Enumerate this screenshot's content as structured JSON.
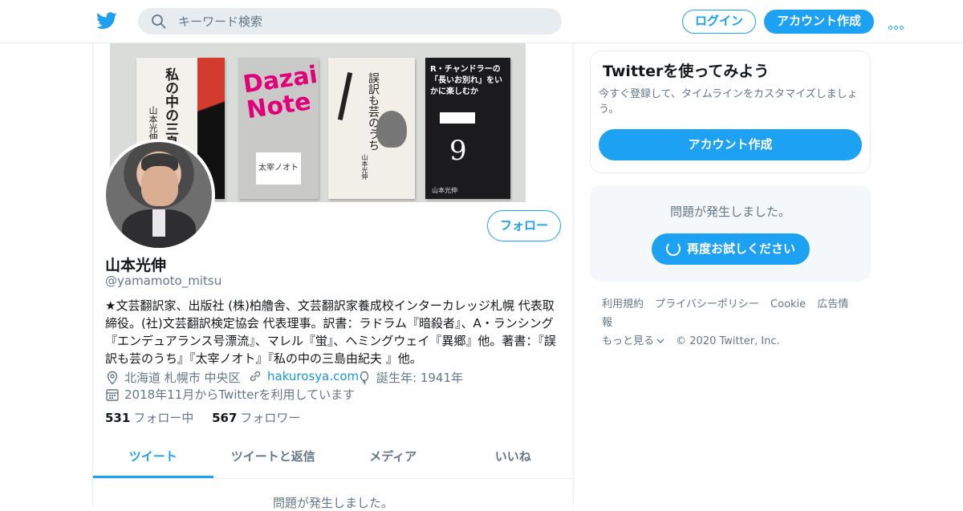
{
  "header": {
    "search_placeholder": "キーワード検索",
    "login": "ログイン",
    "signup": "アカウント作成"
  },
  "banner": {
    "books": [
      {
        "title": "私の中の三島由紀夫",
        "author": "山本光伸"
      },
      {
        "title": "Dazai Note",
        "subtitle": "太宰ノオト"
      },
      {
        "title": "誤訳も芸のうち",
        "author": "山本光伸"
      },
      {
        "title": "R・チャンドラーの「長いお別れ」をいかに楽しむか",
        "author": "山本光伸"
      }
    ]
  },
  "profile": {
    "follow_button": "フォロー",
    "name": "山本光伸",
    "handle": "@yamamoto_mitsu",
    "bio": "★文芸翻訳家、出版社 (株)柏艪舎、文芸翻訳家養成校インターカレッジ札幌 代表取締役。(社)文芸翻訳検定協会 代表理事。訳書：ラドラム『暗殺者』、A・ランシング『エンデュアランス号漂流』、マレル『蛍』、ヘミングウェイ『異郷』他。著書：『誤訳も芸のうち』『太宰ノオト』『私の中の三島由紀夫 』他。",
    "location": "北海道 札幌市 中央区",
    "url": "hakurosya.com",
    "birth": "誕生年: 1941年",
    "joined": "2018年11月からTwitterを利用しています",
    "following_count": "531",
    "following_label": "フォロー中",
    "followers_count": "567",
    "followers_label": "フォロワー"
  },
  "tabs": [
    {
      "label": "ツイート",
      "active": true
    },
    {
      "label": "ツイートと返信"
    },
    {
      "label": "メディア"
    },
    {
      "label": "いいね"
    }
  ],
  "timeline": {
    "error": "問題が発生しました。"
  },
  "sidebar": {
    "card_title": "Twitterを使ってみよう",
    "card_text": "今すぐ登録して、タイムラインをカスタマイズしましょう。",
    "card_signup": "アカウント作成",
    "error_text": "問題が発生しました。",
    "retry": "再度お試しください"
  },
  "footer": {
    "links": [
      "利用規約",
      "プライバシーポリシー",
      "Cookie",
      "広告情報"
    ],
    "more": "もっと見る",
    "copyright": "© 2020 Twitter, Inc."
  },
  "colors": {
    "accent": "#1da1f2",
    "text": "#14171a",
    "muted": "#657786",
    "border": "#e6ecf0"
  }
}
